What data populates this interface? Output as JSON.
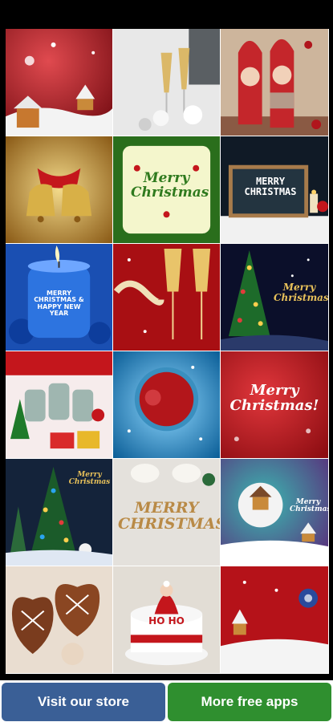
{
  "tiles": [
    {
      "name": "tile-snowy-village",
      "bg": "#9b1c22",
      "accent": "#f2f2f2"
    },
    {
      "name": "tile-champagne-glasses",
      "bg": "#d9d9d9",
      "accent": "#c8a24a"
    },
    {
      "name": "tile-knitted-dolls",
      "bg": "#c9a98a",
      "accent": "#c42a2e"
    },
    {
      "name": "tile-golden-bells",
      "bg": "#b0741d",
      "accent": "#b8141b",
      "text": ""
    },
    {
      "name": "tile-merry-christmas-wreath",
      "bg": "#f2f5c8",
      "accent": "#2f7a1e",
      "text": "Merry Christmas"
    },
    {
      "name": "tile-chalkboard-sign",
      "bg": "#1c2b3a",
      "accent": "#ffffff",
      "text": "MERRY CHRISTMAS"
    },
    {
      "name": "tile-blue-candle",
      "bg": "#1b5fc6",
      "accent": "#ffffff",
      "text": "MERRY CHRISTMAS & HAPPY NEW YEAR"
    },
    {
      "name": "tile-champagne-toast",
      "bg": "#b01417",
      "accent": "#e9c46a"
    },
    {
      "name": "tile-christmas-tree-night",
      "bg": "#0d1030",
      "accent": "#e8c15a",
      "text": "Merry Christmas"
    },
    {
      "name": "tile-snow-globes",
      "bg": "#f3e6e6",
      "accent": "#c4161c",
      "text": ""
    },
    {
      "name": "tile-ornament-frame",
      "bg": "#1f8dc7",
      "accent": "#b3161b"
    },
    {
      "name": "tile-merry-christmas-red",
      "bg": "#b4121a",
      "accent": "#ffffff",
      "text": "Merry Christmas!"
    },
    {
      "name": "tile-lit-tree",
      "bg": "#142237",
      "accent": "#2aa4f0",
      "text": "Merry Christmas"
    },
    {
      "name": "tile-merry-christmas-sand",
      "bg": "#dcdcdc",
      "accent": "#b98a46",
      "text": "MERRY CHRISTMAS"
    },
    {
      "name": "tile-snow-globe-house",
      "bg": "#1e8f8a",
      "accent": "#ffffff",
      "text": "Merry Christmas"
    },
    {
      "name": "tile-gingerbread-cookies",
      "bg": "#5a2e1a",
      "accent": "#ffffff"
    },
    {
      "name": "tile-santa-cake",
      "bg": "#e9e4dd",
      "accent": "#c4161c",
      "text": "HO HO"
    },
    {
      "name": "tile-red-snow-scene",
      "bg": "#b8141b",
      "accent": "#ffffff"
    }
  ],
  "buttons": {
    "store_label": "Visit our store",
    "apps_label": "More free apps",
    "store_color": "#3a5f96",
    "apps_color": "#2f8f2f"
  }
}
